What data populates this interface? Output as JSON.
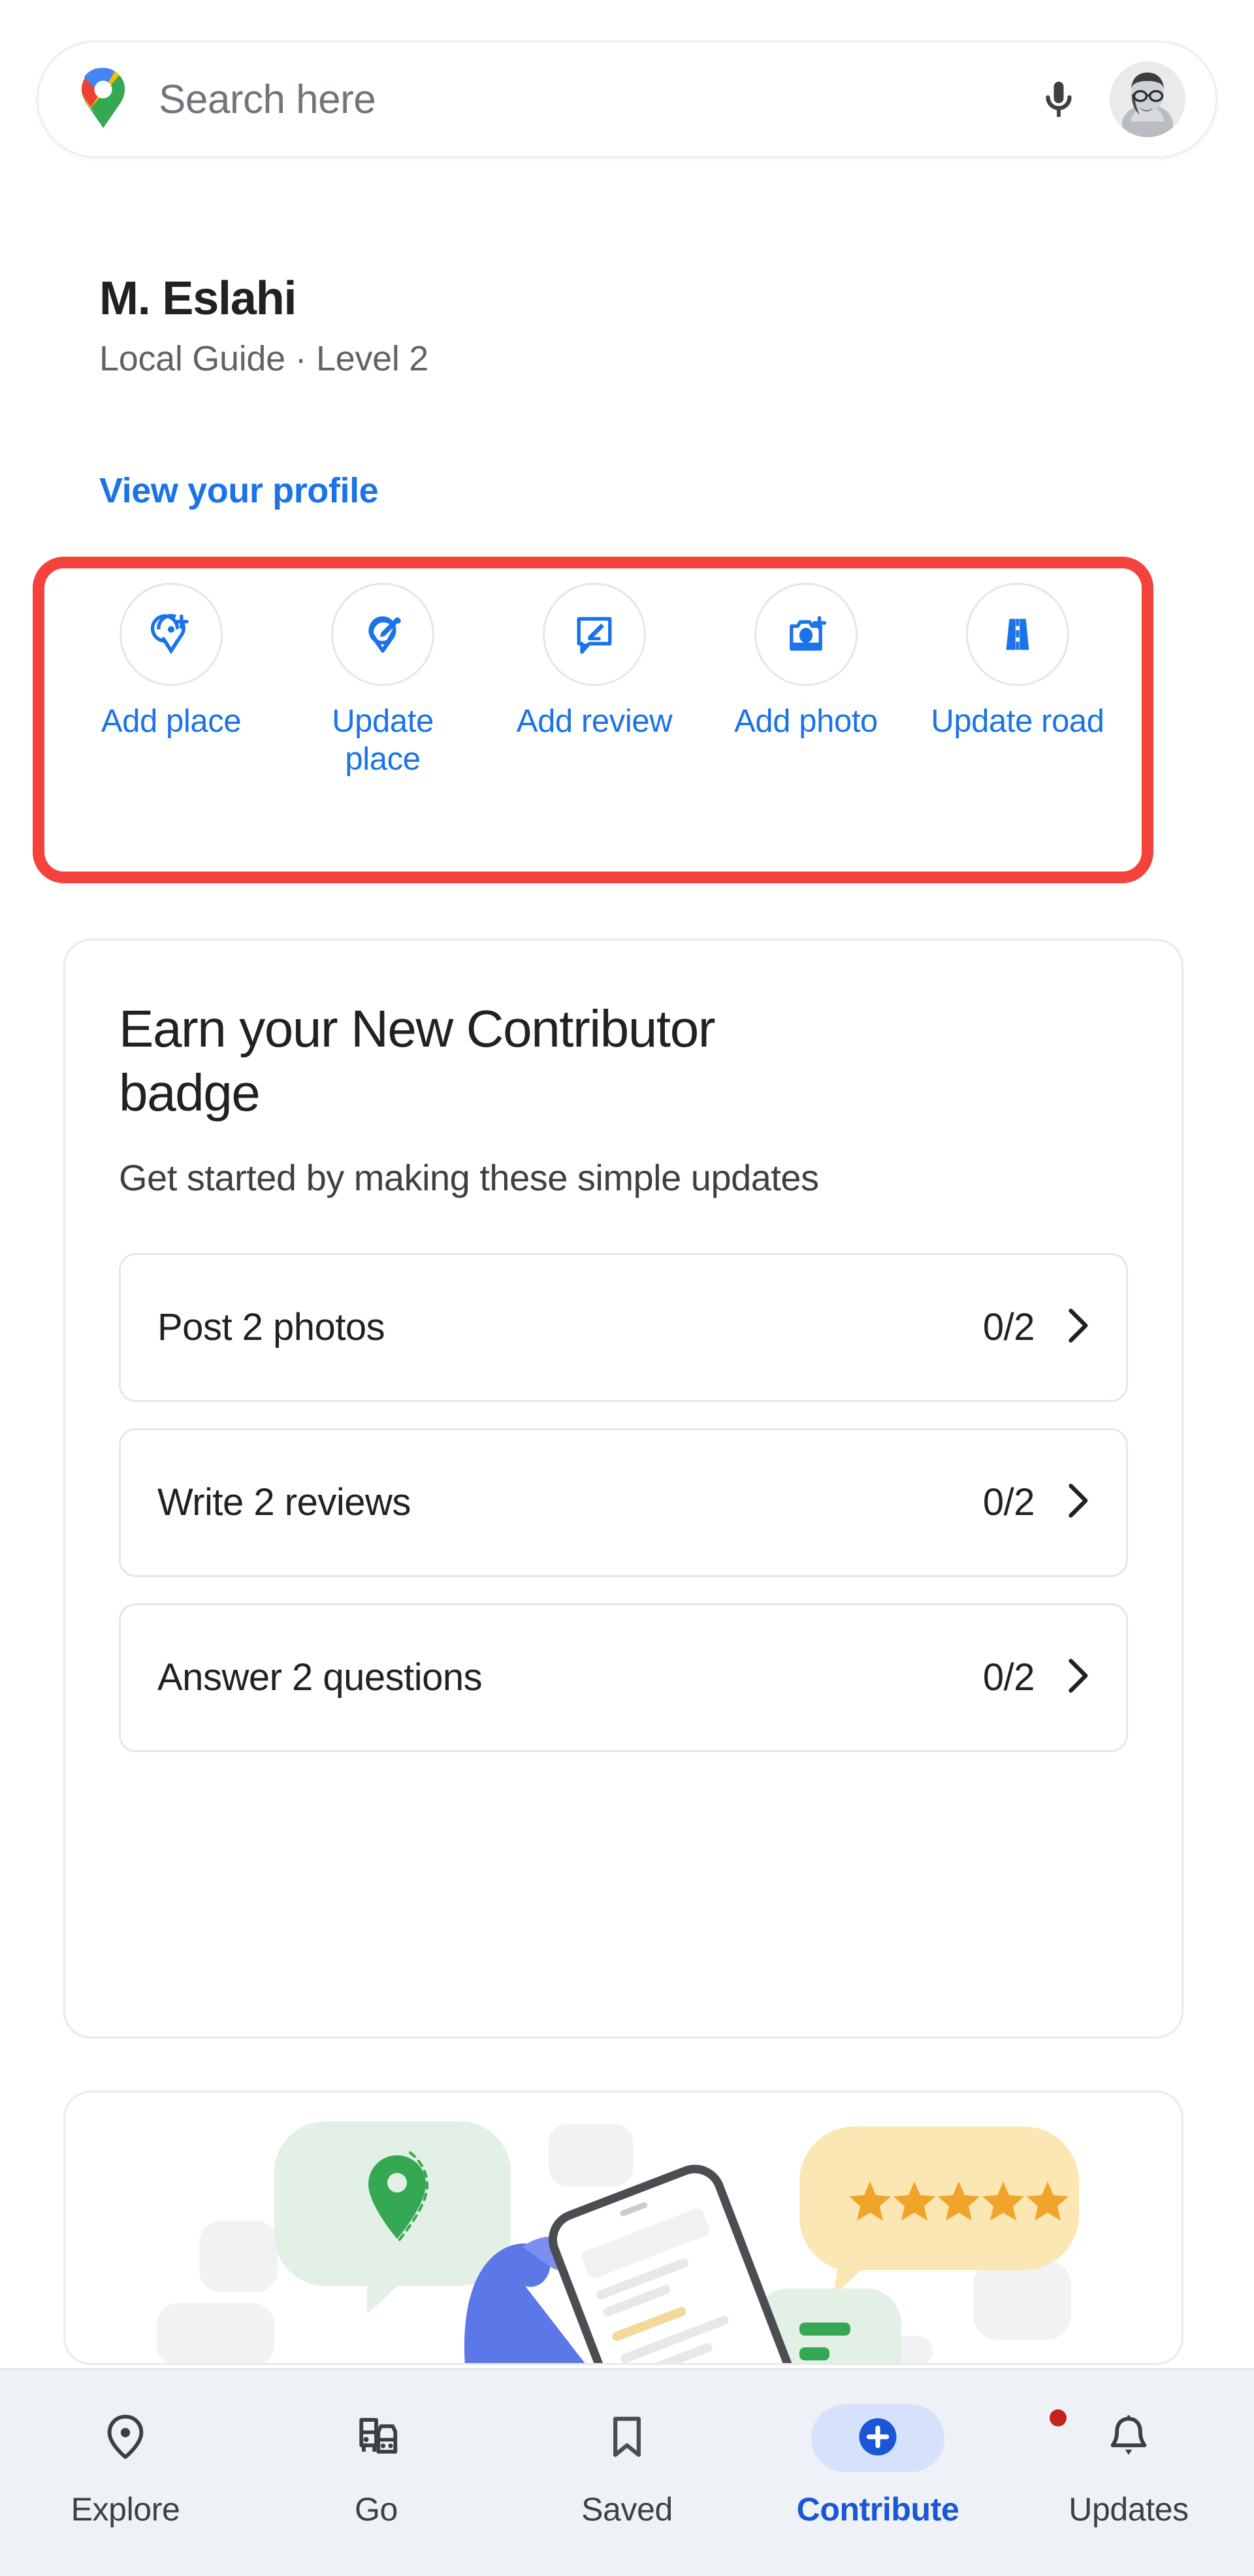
{
  "search": {
    "placeholder": "Search here",
    "value": "Search here",
    "logo_icon": "google-maps-pin-icon",
    "mic_icon": "microphone-icon",
    "avatar_icon": "user-avatar"
  },
  "profile": {
    "name": "M. Eslahi",
    "subtitle": "Local Guide · Level 2",
    "link_label": "View your profile"
  },
  "quick_actions": {
    "items": [
      {
        "label": "Add place",
        "icon": "add-place-pin-icon"
      },
      {
        "label": "Update place",
        "icon": "edit-place-pin-icon"
      },
      {
        "label": "Add review",
        "icon": "add-review-icon"
      },
      {
        "label": "Add photo",
        "icon": "add-photo-camera-icon"
      },
      {
        "label": "Update road",
        "icon": "update-road-icon"
      }
    ],
    "highlight_color": "#f4423c"
  },
  "badge_card": {
    "title": "Earn your New Contributor badge",
    "subtitle": "Get started by making these simple updates",
    "tasks": [
      {
        "label": "Post 2 photos",
        "count": "0/2",
        "chevron": "chevron-right-icon"
      },
      {
        "label": "Write 2 reviews",
        "count": "0/2",
        "chevron": "chevron-right-icon"
      },
      {
        "label": "Answer 2 questions",
        "count": "0/2",
        "chevron": "chevron-right-icon"
      }
    ]
  },
  "illustration_card": {
    "alt": "Person holding phone with map pin, review stars and chat bubbles",
    "stars": 5,
    "star_color": "#f0a52a",
    "bubble_color": "#fbe7b3",
    "pin_color": "#34a853",
    "hand_color": "#5b77e8"
  },
  "bottom_nav": {
    "items": [
      {
        "label": "Explore",
        "icon": "map-pin-icon",
        "active": false,
        "badge": false
      },
      {
        "label": "Go",
        "icon": "commute-icon",
        "active": false,
        "badge": false
      },
      {
        "label": "Saved",
        "icon": "bookmark-icon",
        "active": false,
        "badge": false
      },
      {
        "label": "Contribute",
        "icon": "plus-circle-icon",
        "active": true,
        "badge": false
      },
      {
        "label": "Updates",
        "icon": "bell-icon",
        "active": false,
        "badge": true
      }
    ],
    "active_color": "#1a56d6",
    "inactive_color": "#3c4043",
    "badge_color": "#c5221f"
  }
}
